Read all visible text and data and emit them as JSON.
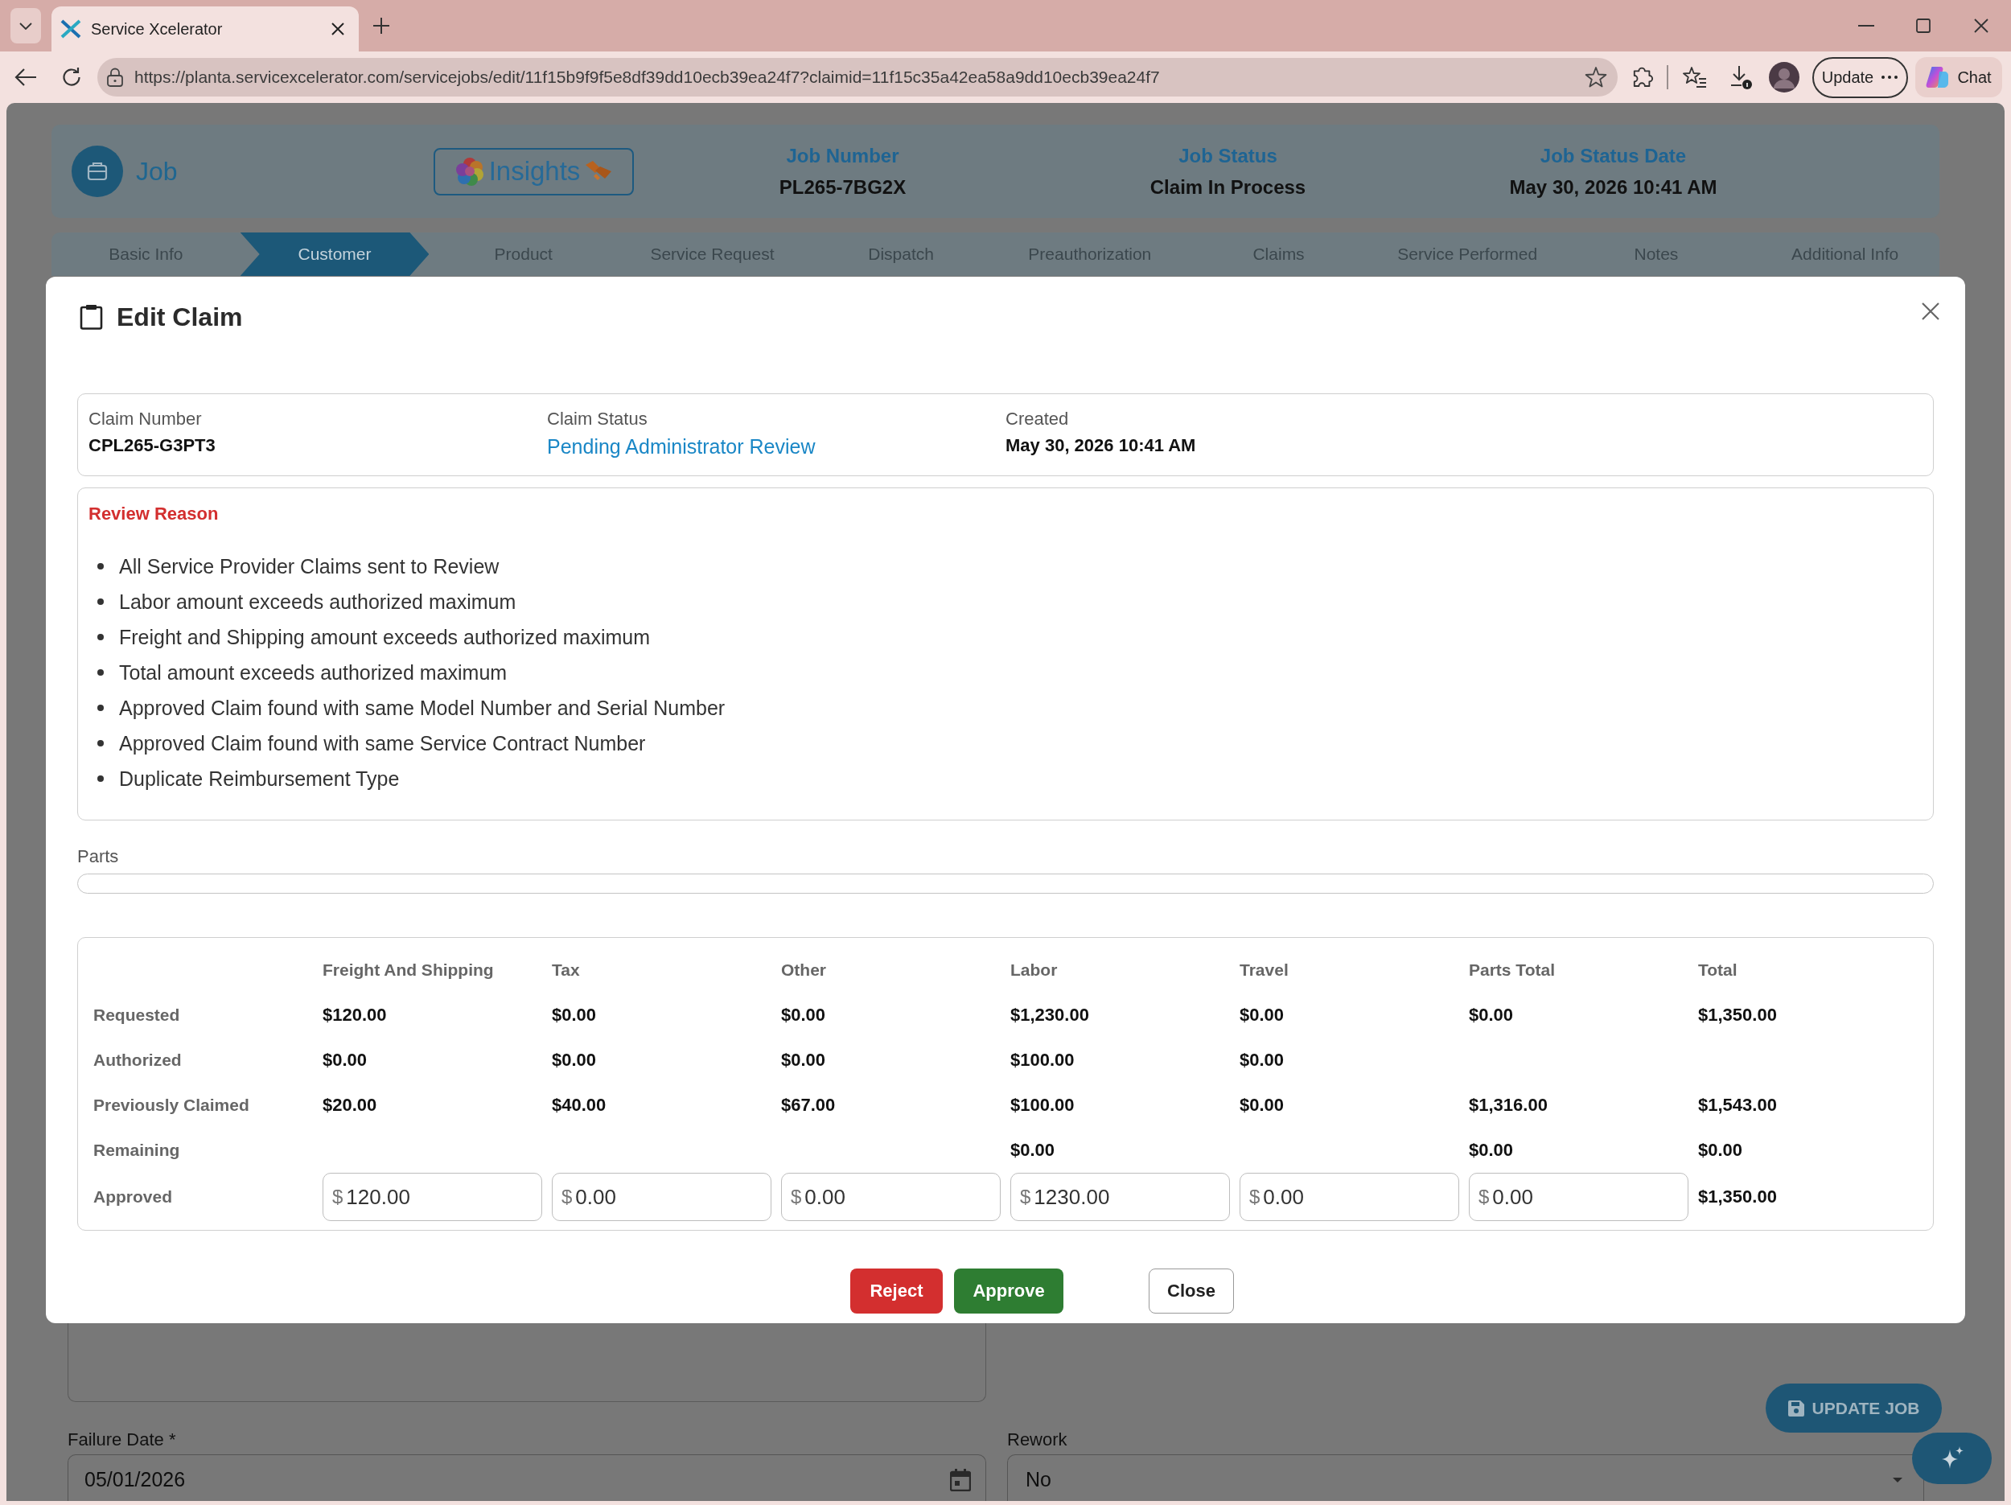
{
  "browser": {
    "tab_title": "Service Xcelerator",
    "url": "https://planta.servicexcelerator.com/servicejobs/edit/11f15b9f9f5e8df39dd10ecb39ea24f7?claimid=11f15c35a42ea58a9dd10ecb39ea24f7",
    "update_button": "Update",
    "chat_button": "Chat"
  },
  "header": {
    "title": "Job",
    "insights_button": "Insights",
    "fields": [
      {
        "label": "Job Number",
        "value": "PL265-7BG2X"
      },
      {
        "label": "Job Status",
        "value": "Claim In Process"
      },
      {
        "label": "Job Status Date",
        "value": "May 30, 2026 10:41 AM"
      }
    ]
  },
  "tabs": [
    {
      "label": "Basic Info",
      "selected": false
    },
    {
      "label": "Customer",
      "selected": true
    },
    {
      "label": "Product",
      "selected": false
    },
    {
      "label": "Service Request",
      "selected": false
    },
    {
      "label": "Dispatch",
      "selected": false
    },
    {
      "label": "Preauthorization",
      "selected": false
    },
    {
      "label": "Claims",
      "selected": false
    },
    {
      "label": "Service Performed",
      "selected": false
    },
    {
      "label": "Notes",
      "selected": false
    },
    {
      "label": "Additional Info",
      "selected": false
    }
  ],
  "dialog": {
    "title": "Edit Claim",
    "summary": [
      {
        "label": "Claim Number",
        "value": "CPL265-G3PT3",
        "kind": "text"
      },
      {
        "label": "Claim Status",
        "value": "Pending Administrator Review",
        "kind": "status"
      },
      {
        "label": "Created",
        "value": "May 30, 2026 10:41 AM",
        "kind": "text"
      }
    ],
    "review_reason": {
      "title": "Review Reason",
      "items": [
        "All Service Provider Claims sent to Review",
        "Labor amount exceeds authorized maximum",
        "Freight and Shipping amount exceeds authorized maximum",
        "Total amount exceeds authorized maximum",
        "Approved Claim found with same Model Number and Serial Number",
        "Approved Claim found with same Service Contract Number",
        "Duplicate Reimbursement Type"
      ]
    },
    "parts": {
      "label": "Parts"
    },
    "amounts": {
      "columns": [
        "Freight And Shipping",
        "Tax",
        "Other",
        "Labor",
        "Travel",
        "Parts Total",
        "Total"
      ],
      "rows": [
        {
          "label": "Requested",
          "cells": [
            {
              "kind": "text",
              "value": "$120.00"
            },
            {
              "kind": "text",
              "value": "$0.00"
            },
            {
              "kind": "text",
              "value": "$0.00"
            },
            {
              "kind": "text",
              "value": "$1,230.00"
            },
            {
              "kind": "text",
              "value": "$0.00"
            },
            {
              "kind": "text",
              "value": "$0.00"
            },
            {
              "kind": "text",
              "value": "$1,350.00"
            }
          ]
        },
        {
          "label": "Authorized",
          "cells": [
            {
              "kind": "text",
              "value": "$0.00"
            },
            {
              "kind": "text",
              "value": "$0.00"
            },
            {
              "kind": "text",
              "value": "$0.00"
            },
            {
              "kind": "text",
              "value": "$100.00"
            },
            {
              "kind": "text",
              "value": "$0.00"
            },
            null,
            null
          ]
        },
        {
          "label": "Previously Claimed",
          "cells": [
            {
              "kind": "text",
              "value": "$20.00"
            },
            {
              "kind": "text",
              "value": "$40.00"
            },
            {
              "kind": "text",
              "value": "$67.00"
            },
            {
              "kind": "text",
              "value": "$100.00"
            },
            {
              "kind": "text",
              "value": "$0.00"
            },
            {
              "kind": "text",
              "value": "$1,316.00"
            },
            {
              "kind": "text",
              "value": "$1,543.00"
            }
          ]
        },
        {
          "label": "Remaining",
          "cells": [
            null,
            null,
            null,
            {
              "kind": "text",
              "value": "$0.00"
            },
            null,
            {
              "kind": "text",
              "value": "$0.00"
            },
            {
              "kind": "text",
              "value": "$0.00"
            }
          ]
        },
        {
          "label": "Approved",
          "cells": [
            {
              "kind": "input",
              "prefix": "$",
              "value": "120.00"
            },
            {
              "kind": "input",
              "prefix": "$",
              "value": "0.00"
            },
            {
              "kind": "input",
              "prefix": "$",
              "value": "0.00"
            },
            {
              "kind": "input",
              "prefix": "$",
              "value": "1230.00"
            },
            {
              "kind": "input",
              "prefix": "$",
              "value": "0.00"
            },
            {
              "kind": "input",
              "prefix": "$",
              "value": "0.00"
            },
            {
              "kind": "text",
              "value": "$1,350.00"
            }
          ]
        }
      ]
    },
    "buttons": [
      {
        "label": "Reject",
        "kind": "danger"
      },
      {
        "label": "Approve",
        "kind": "success"
      },
      {
        "label": "Close",
        "kind": "outline"
      }
    ]
  },
  "form": {
    "fields": [
      {
        "kind": "date",
        "label": "Failure Date *",
        "value": "05/01/2026"
      },
      {
        "kind": "select",
        "label": "Rework",
        "value": "No"
      }
    ]
  },
  "update_job_button": "UPDATE JOB"
}
